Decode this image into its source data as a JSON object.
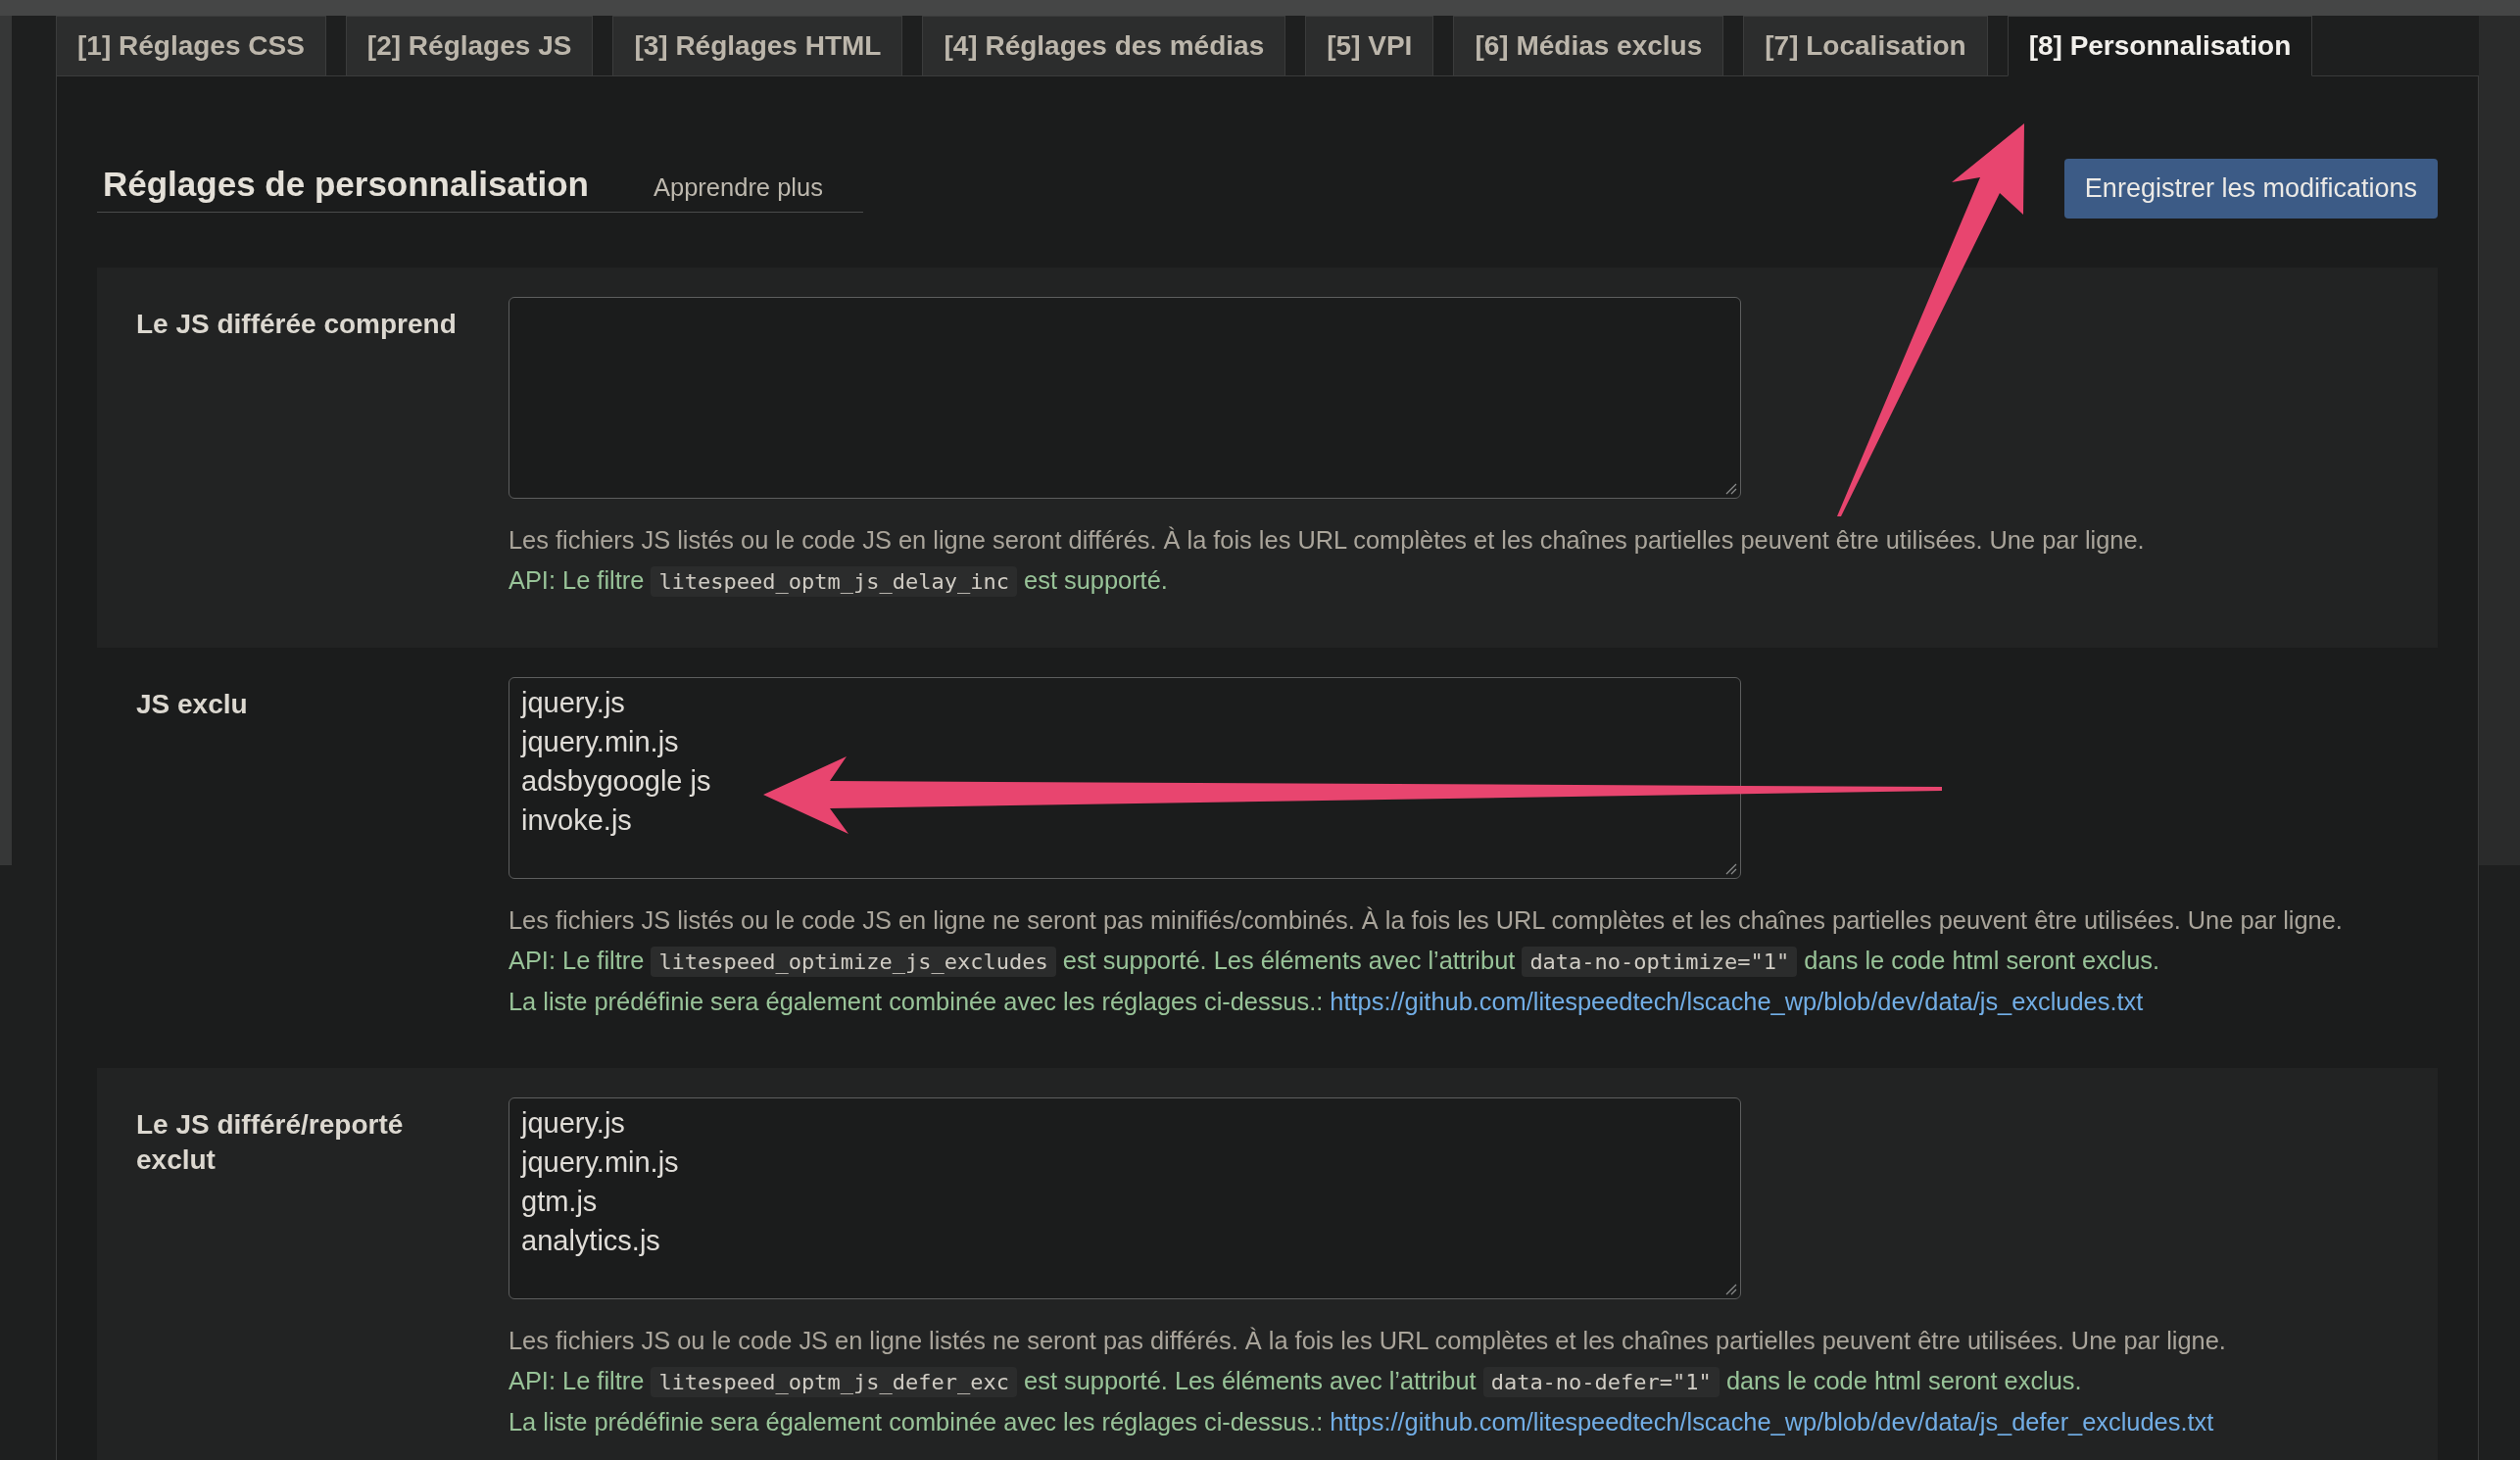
{
  "tabs": [
    {
      "label": "[1] Réglages CSS",
      "selected": false
    },
    {
      "label": "[2] Réglages JS",
      "selected": false
    },
    {
      "label": "[3] Réglages HTML",
      "selected": false
    },
    {
      "label": "[4] Réglages des médias",
      "selected": false
    },
    {
      "label": "[5] VPI",
      "selected": false
    },
    {
      "label": "[6] Médias exclus",
      "selected": false
    },
    {
      "label": "[7] Localisation",
      "selected": false
    },
    {
      "label": "[8] Personnalisation",
      "selected": true
    }
  ],
  "header": {
    "title": "Réglages de personnalisation",
    "link": "Apprendre plus"
  },
  "save_button": "Enregistrer les modifications",
  "settings": [
    {
      "label": "Le JS différée comprend",
      "notes": [
        {
          "kind": "description",
          "parts": [
            {
              "kind": "text",
              "text": "Les fichiers JS listés ou le code JS en ligne seront différés. À la fois les URL complètes et les chaînes partielles peuvent être utilisées. Une par ligne."
            }
          ]
        },
        {
          "kind": "api",
          "parts": [
            {
              "kind": "text",
              "text": "API: Le filtre"
            },
            {
              "kind": "code",
              "text": "litespeed_optm_js_delay_inc"
            },
            {
              "kind": "text",
              "text": "est supporté."
            }
          ]
        }
      ]
    },
    {
      "label": "JS exclu",
      "value": [
        "jquery.js",
        "jquery.min.js",
        "adsbygoogle js",
        "invoke.js"
      ],
      "notes": [
        {
          "kind": "description",
          "parts": [
            {
              "kind": "text",
              "text": "Les fichiers JS listés ou le code JS en ligne ne seront pas minifiés/combinés. À la fois les URL complètes et les chaînes partielles peuvent être utilisées. Une par ligne."
            }
          ]
        },
        {
          "kind": "api",
          "parts": [
            {
              "kind": "text",
              "text": "API: Le filtre"
            },
            {
              "kind": "code",
              "text": "litespeed_optimize_js_excludes"
            },
            {
              "kind": "text",
              "text": "est supporté. Les éléments avec l’attribut"
            },
            {
              "kind": "code",
              "text": "data-no-optimize=\"1\""
            },
            {
              "kind": "text",
              "text": "dans le code html seront exclus."
            }
          ]
        },
        {
          "kind": "predefined",
          "parts": [
            {
              "kind": "text",
              "text": "La liste prédéfinie sera également combinée avec les réglages ci-dessus.:"
            },
            {
              "kind": "link",
              "text": "https://github.com/litespeedtech/lscache_wp/blob/dev/data/js_excludes.txt"
            }
          ]
        }
      ]
    },
    {
      "label": "Le JS différé/reporté exclut",
      "value": [
        "jquery.js",
        "jquery.min.js",
        "gtm.js",
        "analytics.js"
      ],
      "notes": [
        {
          "kind": "description",
          "parts": [
            {
              "kind": "text",
              "text": "Les fichiers JS ou le code JS en ligne listés ne seront pas différés. À la fois les URL complètes et les chaînes partielles peuvent être utilisées. Une par ligne."
            }
          ]
        },
        {
          "kind": "api",
          "parts": [
            {
              "kind": "text",
              "text": "API: Le filtre"
            },
            {
              "kind": "code",
              "text": "litespeed_optm_js_defer_exc"
            },
            {
              "kind": "text",
              "text": "est supporté. Les éléments avec l’attribut"
            },
            {
              "kind": "code",
              "text": "data-no-defer=\"1\""
            },
            {
              "kind": "text",
              "text": "dans le code html seront exclus."
            }
          ]
        },
        {
          "kind": "predefined",
          "parts": [
            {
              "kind": "text",
              "text": "La liste prédéfinie sera également combinée avec les réglages ci-dessus.:"
            },
            {
              "kind": "link",
              "text": "https://github.com/litespeedtech/lscache_wp/blob/dev/data/js_defer_excludes.txt"
            }
          ]
        }
      ]
    }
  ]
}
